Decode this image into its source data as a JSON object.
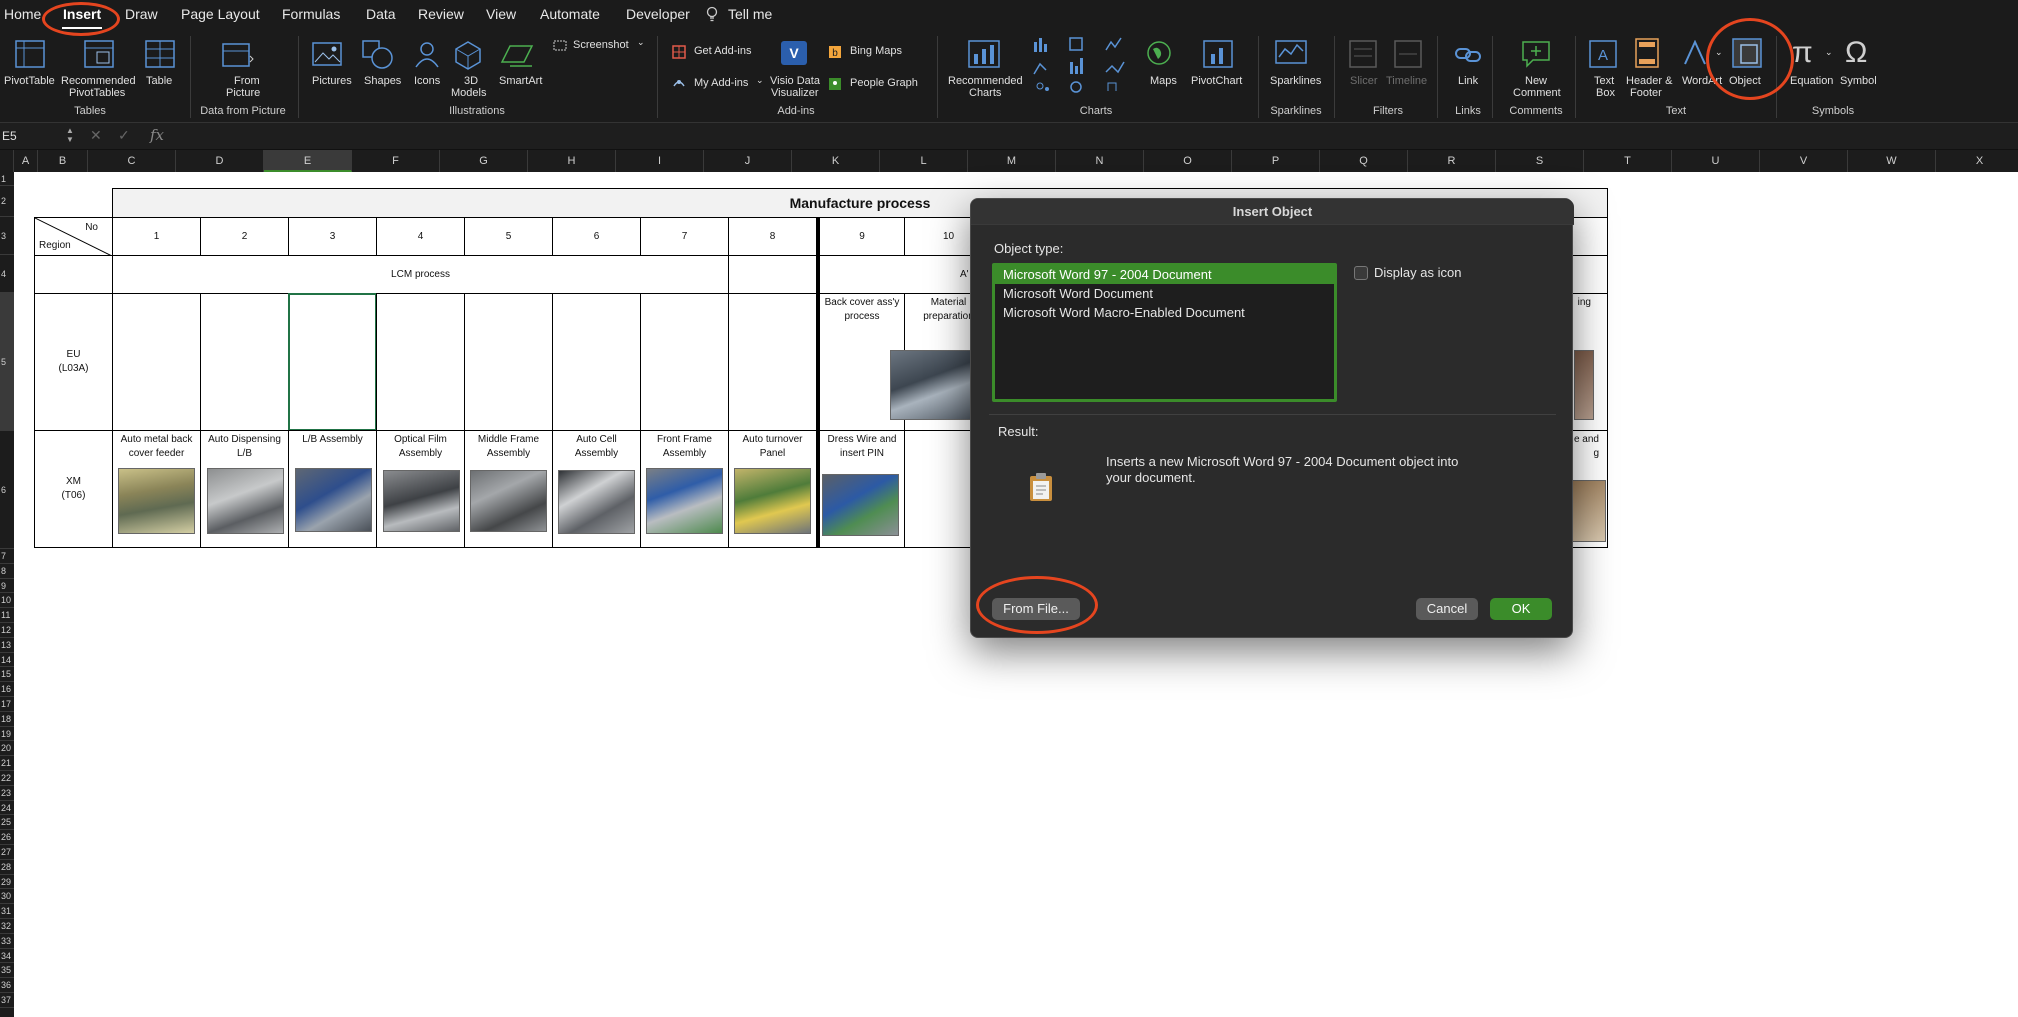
{
  "ribbon": {
    "tabs": [
      "Home",
      "Insert",
      "Draw",
      "Page Layout",
      "Formulas",
      "Data",
      "Review",
      "View",
      "Automate",
      "Developer",
      "Tell me"
    ],
    "groups": {
      "tables": "Tables",
      "data_from_picture": "Data from Picture",
      "illustrations": "Illustrations",
      "addins": "Add-ins",
      "charts": "Charts",
      "sparklines": "Sparklines",
      "filters": "Filters",
      "links": "Links",
      "comments": "Comments",
      "text": "Text",
      "symbols": "Symbols"
    },
    "buttons": {
      "pivottable": "PivotTable",
      "recommended_pivot": [
        "Recommended",
        "PivotTables"
      ],
      "table": "Table",
      "from_picture": [
        "From",
        "Picture"
      ],
      "pictures": "Pictures",
      "shapes": "Shapes",
      "icons": "Icons",
      "models_3d": [
        "3D",
        "Models"
      ],
      "smartart": "SmartArt",
      "screenshot": "Screenshot",
      "get_addins": "Get Add-ins",
      "my_addins": "My Add-ins",
      "visio": [
        "Visio Data",
        "Visualizer"
      ],
      "bing_maps": "Bing Maps",
      "people_graph": "People Graph",
      "recommended_charts": [
        "Recommended",
        "Charts"
      ],
      "maps": "Maps",
      "pivotchart": "PivotChart",
      "sparklines": "Sparklines",
      "slicer": "Slicer",
      "timeline": "Timeline",
      "link": "Link",
      "new_comment": [
        "New",
        "Comment"
      ],
      "text_box": [
        "Text",
        "Box"
      ],
      "header_footer": [
        "Header &",
        "Footer"
      ],
      "wordart": "WordArt",
      "object": "Object",
      "equation": "Equation",
      "symbol": "Symbol"
    }
  },
  "formula_bar": {
    "name_box": "E5",
    "fx": "fx"
  },
  "columns": [
    "A",
    "B",
    "C",
    "D",
    "E",
    "F",
    "G",
    "H",
    "I",
    "J",
    "K",
    "L",
    "M",
    "N",
    "O",
    "P",
    "Q",
    "R",
    "S",
    "T",
    "U",
    "V",
    "W",
    "X"
  ],
  "rows": [
    "1",
    "2",
    "3",
    "4",
    "5",
    "6",
    "7",
    "8",
    "9",
    "10",
    "11",
    "12",
    "13",
    "14",
    "15",
    "16",
    "17",
    "18",
    "19",
    "20",
    "21",
    "22",
    "23",
    "24",
    "25",
    "26",
    "27",
    "28",
    "29",
    "30",
    "31",
    "32",
    "33",
    "34",
    "35",
    "36",
    "37"
  ],
  "sheet": {
    "title": "Manufacture process",
    "corner": {
      "no": "No",
      "region": "Region"
    },
    "numbers": [
      "1",
      "2",
      "3",
      "4",
      "5",
      "6",
      "7",
      "8",
      "9",
      "10"
    ],
    "lcm": "LCM process",
    "assy_partial": "A'",
    "eu_region": [
      "EU",
      "(L03A)"
    ],
    "xm_region": [
      "XM",
      "(T06)"
    ],
    "eu_k": [
      "Back cover ass'y",
      "process"
    ],
    "eu_l": [
      "Material",
      "preparation"
    ],
    "eu_right_partial": "ing",
    "xm_processes": [
      [
        "Auto metal back",
        "cover feeder"
      ],
      [
        "Auto Dispensing",
        "L/B"
      ],
      [
        "L/B Assembly",
        ""
      ],
      [
        "Optical Film",
        "Assembly"
      ],
      [
        "Middle Frame",
        "Assembly"
      ],
      [
        "Auto Cell",
        "Assembly"
      ],
      [
        "Front Frame",
        "Assembly"
      ],
      [
        "Auto turnover",
        "Panel"
      ],
      [
        "Dress Wire and",
        "insert PIN"
      ]
    ],
    "xm_right_partial": [
      "e and",
      "g"
    ]
  },
  "dialog": {
    "title": "Insert Object",
    "object_type_label": "Object type:",
    "options": [
      "Microsoft Word 97 - 2004 Document",
      "Microsoft Word Document",
      "Microsoft Word Macro-Enabled Document"
    ],
    "selected_index": 0,
    "display_as_icon": "Display as icon",
    "display_as_icon_checked": false,
    "result_label": "Result:",
    "result_text": [
      "Inserts a new Microsoft Word 97 - 2004 Document object into",
      "your document."
    ],
    "from_file": "From File...",
    "cancel": "Cancel",
    "ok": "OK"
  },
  "colors": {
    "accent_green": "#3b8c2a",
    "annotation": "#e5451f",
    "ribbon_bg": "#1b1b1b"
  }
}
